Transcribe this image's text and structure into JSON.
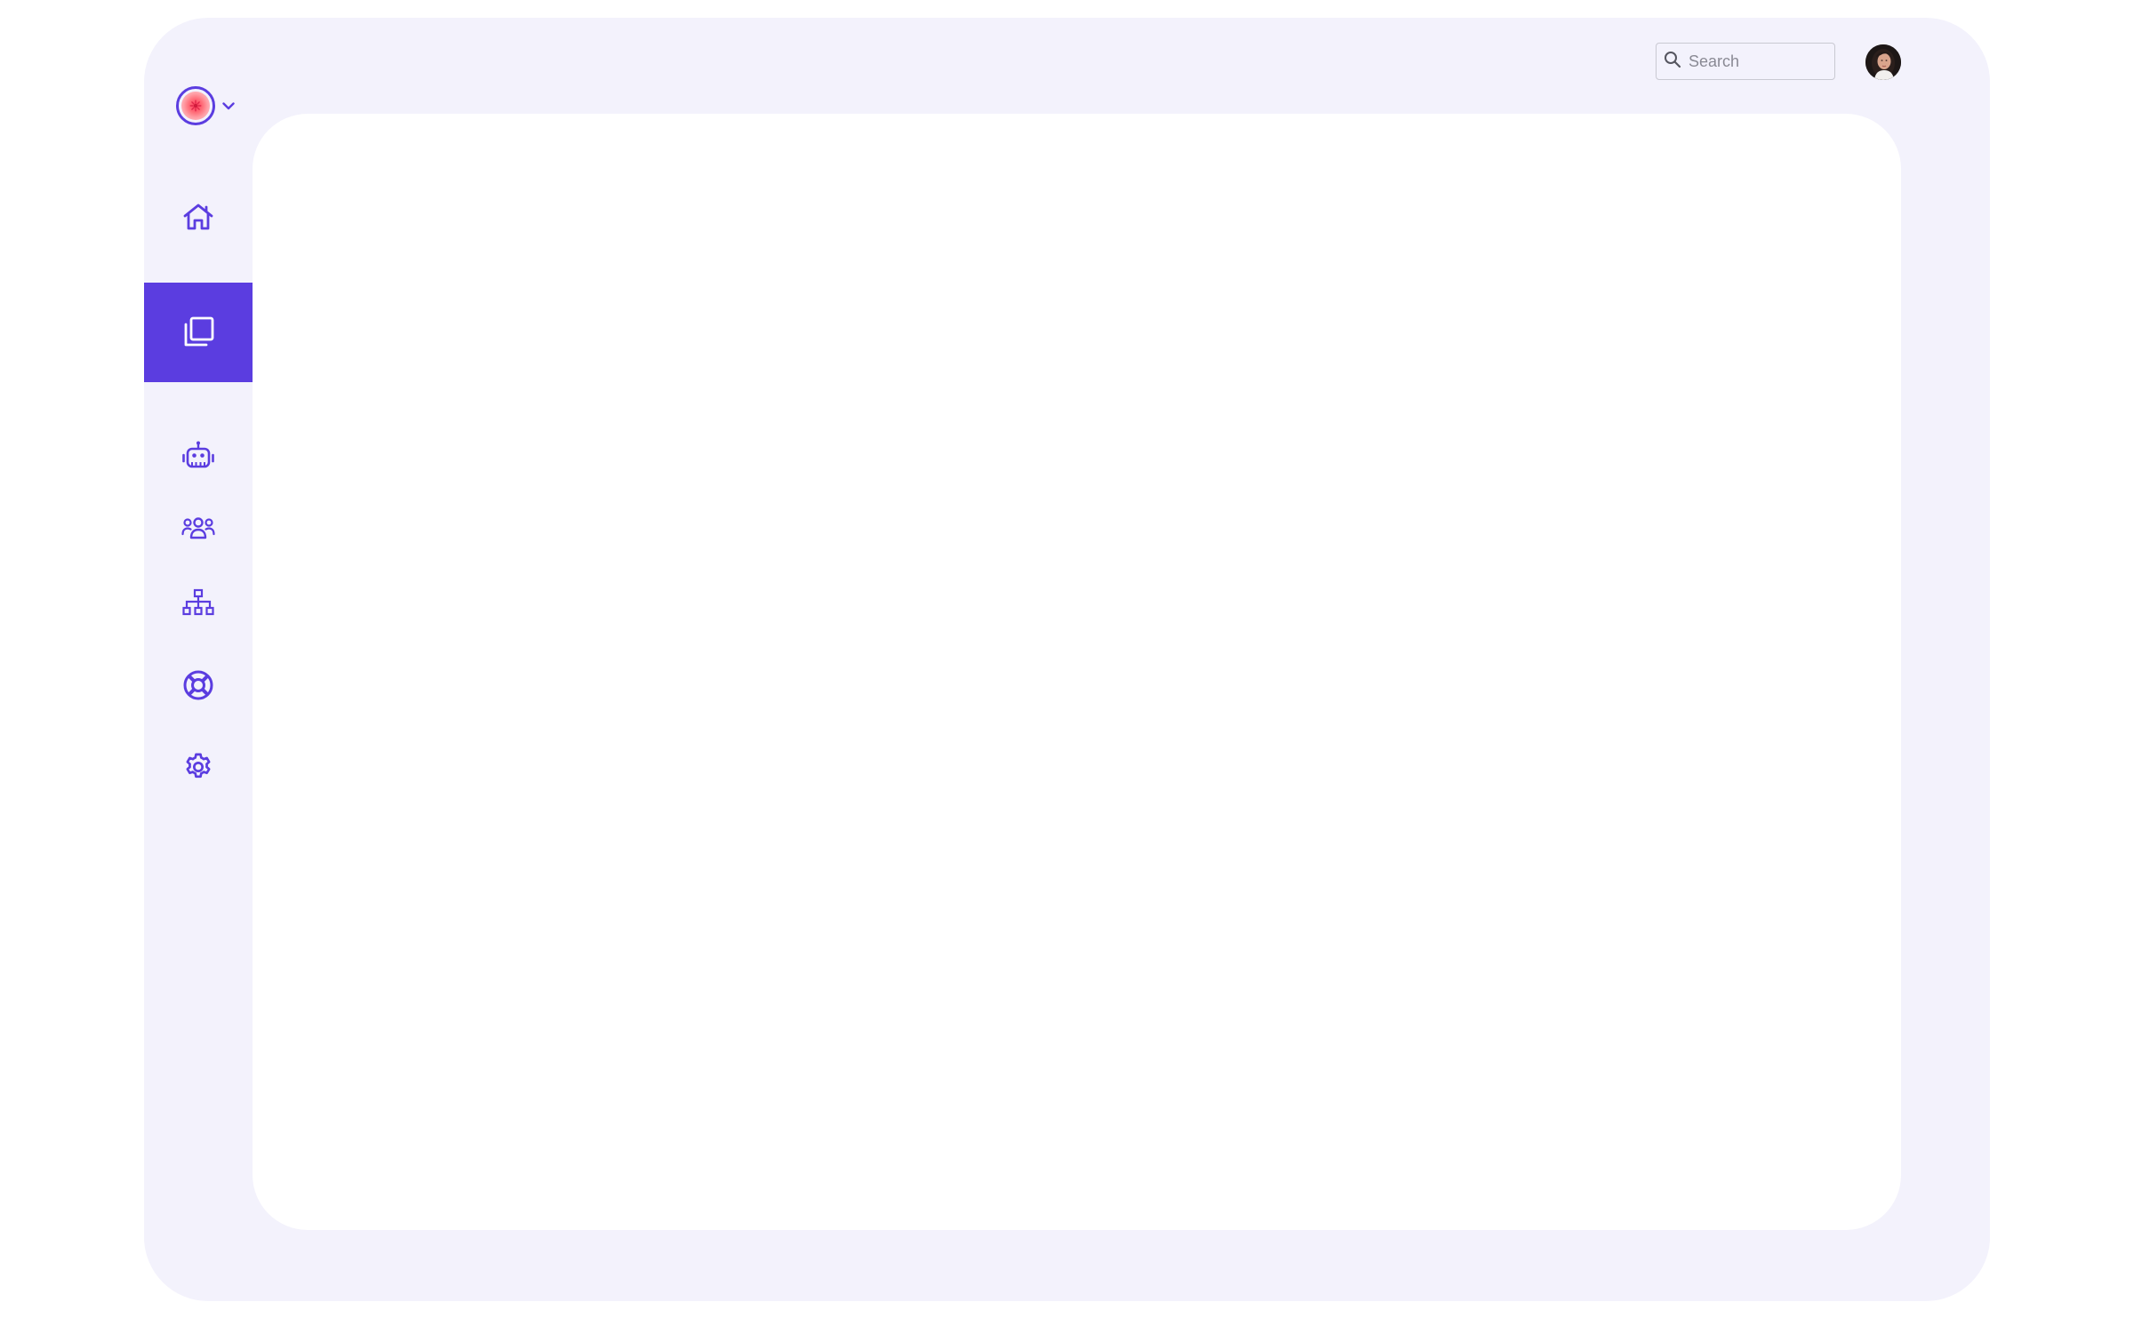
{
  "brand": {
    "logo_icon": "flower-logo-icon",
    "dropdown_icon": "chevron-down-icon"
  },
  "search": {
    "placeholder": "Search",
    "value": "",
    "icon": "search-icon"
  },
  "user": {
    "avatar_icon": "user-avatar"
  },
  "sidebar": {
    "items": [
      {
        "id": "home",
        "icon": "home-icon",
        "active": false
      },
      {
        "id": "documents",
        "icon": "copy-icon",
        "active": true
      },
      {
        "id": "bots",
        "icon": "robot-icon",
        "active": false
      },
      {
        "id": "team",
        "icon": "users-icon",
        "active": false
      },
      {
        "id": "organization",
        "icon": "hierarchy-icon",
        "active": false
      },
      {
        "id": "support",
        "icon": "lifebuoy-icon",
        "active": false
      },
      {
        "id": "settings",
        "icon": "gear-icon",
        "active": false
      }
    ]
  },
  "colors": {
    "accent": "#5b3de0",
    "frame_background": "#f3f2fc",
    "panel_background": "#ffffff",
    "icon_inactive": "#5b3de0",
    "icon_active": "#ffffff"
  }
}
